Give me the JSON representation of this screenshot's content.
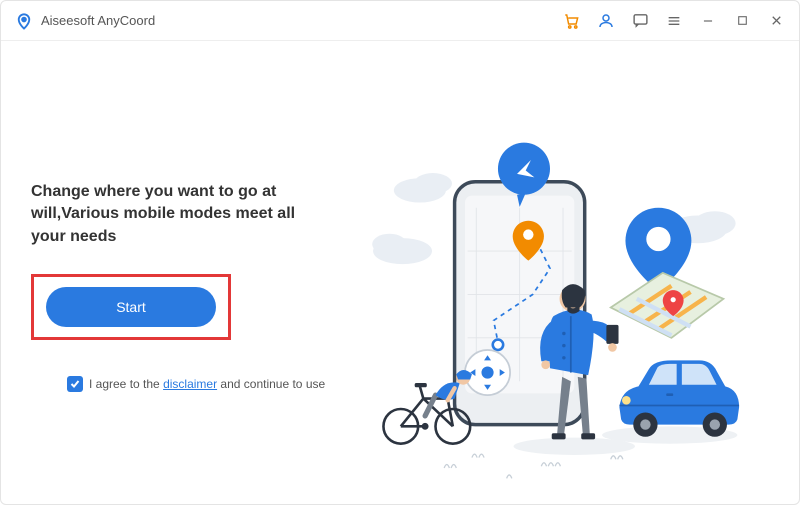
{
  "app": {
    "title": "Aiseesoft AnyCoord"
  },
  "main": {
    "headline": "Change where you want to go at will,Various mobile modes meet all your needs",
    "start_label": "Start",
    "agree_prefix": "I agree to the ",
    "agree_link": "disclaimer",
    "agree_suffix": " and continue to use",
    "agree_checked": true
  },
  "icons": {
    "cart": "cart-icon",
    "user": "user-icon",
    "feedback": "speech-icon",
    "menu": "hamburger-icon",
    "minimize": "minimize-icon",
    "maximize": "maximize-icon",
    "close": "close-icon"
  },
  "colors": {
    "accent": "#2a7ae0",
    "highlight_box": "#e33838"
  }
}
